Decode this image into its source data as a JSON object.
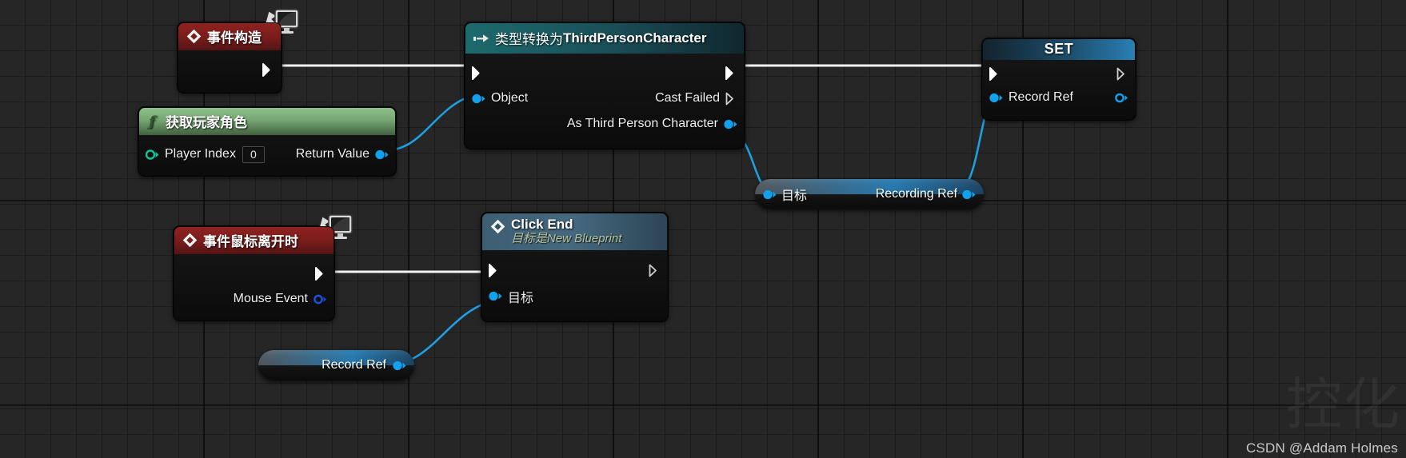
{
  "graph": {
    "background_color": "#262626",
    "grid_color": "#1a1a1a"
  },
  "nodes": {
    "event_construct": {
      "title": "事件构造",
      "icon": "event-diamond-icon",
      "badge": "monitor-icon",
      "exec_out": "exec-out-pin"
    },
    "get_player_character": {
      "title": "获取玩家角色",
      "icon": "function-f-icon",
      "input_label": "Player Index",
      "input_value": "0",
      "output_label": "Return Value"
    },
    "cast_node": {
      "title_prefix": "类型转换为 ",
      "title_target": "ThirdPersonCharacter",
      "icon": "cast-arrow-icon",
      "input_object": "Object",
      "output_cast_failed": "Cast Failed",
      "output_as_character": "As Third Person Character"
    },
    "set_node": {
      "title": "SET",
      "input_label": "Record Ref"
    },
    "recording_ref_getter": {
      "input_label": "目标",
      "output_label": "Recording Ref"
    },
    "event_mouse_leave": {
      "title": "事件鼠标离开时",
      "icon": "event-diamond-icon",
      "badge": "monitor-icon",
      "output_label": "Mouse Event"
    },
    "click_end": {
      "title": "Click End",
      "subtitle": "目标是New Blueprint",
      "icon": "event-diamond-icon",
      "input_target": "目标"
    },
    "record_ref_getter": {
      "label": "Record Ref"
    }
  },
  "watermark": {
    "mark": "控化",
    "credit": "CSDN @Addam Holmes"
  },
  "colors": {
    "exec_wire": "#f2f2f2",
    "data_wire": "#1d9fe0",
    "object_pin": "#12a1ec",
    "event_red": "#8e2220",
    "function_green": "#76a772",
    "cast_cyan": "#1a5f68",
    "set_blue": "#2a7fb4"
  }
}
